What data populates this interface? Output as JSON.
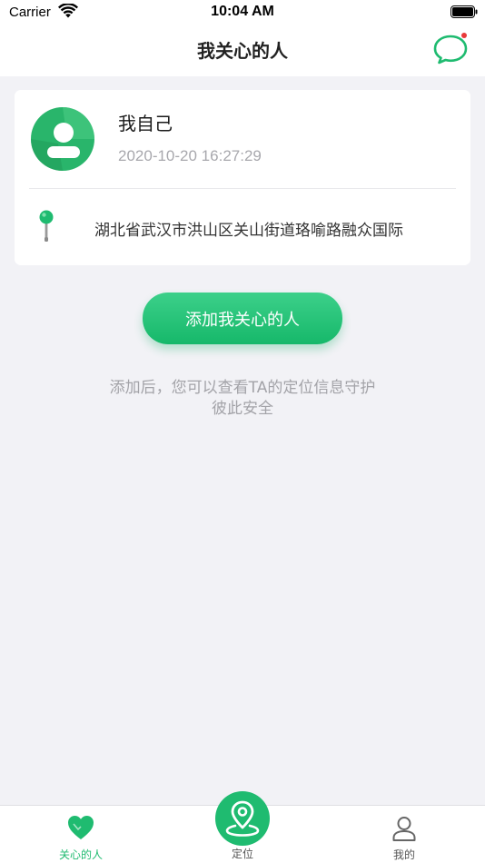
{
  "status_bar": {
    "carrier": "Carrier",
    "time": "10:04 AM"
  },
  "nav": {
    "title": "我关心的人",
    "message_icon": "chat-bubble-icon"
  },
  "card": {
    "name": "我自己",
    "timestamp": "2020-10-20 16:27:29",
    "address": "湖北省武汉市洪山区关山街道珞喻路融众国际"
  },
  "add_button": {
    "label": "添加我关心的人"
  },
  "hint": {
    "line1": "添加后，您可以查看TA的定位信息守护",
    "line2": "彼此安全"
  },
  "tabs": [
    {
      "label": "关心的人",
      "icon": "heart-icon",
      "active": true
    },
    {
      "label": "定位",
      "icon": "location-pin-icon",
      "active": false
    },
    {
      "label": "我的",
      "icon": "user-icon",
      "active": false
    }
  ],
  "colors": {
    "accent": "#1fbb70",
    "background": "#f2f2f6",
    "badge": "#e83a3a"
  }
}
